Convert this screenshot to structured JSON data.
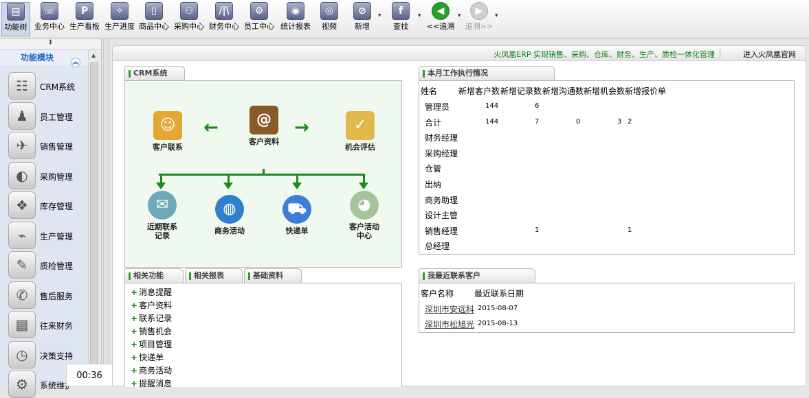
{
  "toolbar": [
    {
      "label": "功能树",
      "icon": "function-tree-icon",
      "glyph": "▤"
    },
    {
      "label": "业务中心",
      "icon": "business-center-icon",
      "glyph": "☏"
    },
    {
      "label": "生产看板",
      "icon": "production-board-icon",
      "glyph": "P"
    },
    {
      "label": "生产进度",
      "icon": "production-progress-icon",
      "glyph": "✧"
    },
    {
      "label": "商品中心",
      "icon": "product-center-icon",
      "glyph": "▯"
    },
    {
      "label": "采购中心",
      "icon": "purchase-center-icon",
      "glyph": "⚇"
    },
    {
      "label": "财务中心",
      "icon": "finance-center-icon",
      "glyph": "/|\\"
    },
    {
      "label": "员工中心",
      "icon": "staff-center-icon",
      "glyph": "⚙"
    },
    {
      "label": "统计报表",
      "icon": "statistics-report-icon",
      "glyph": "◉"
    },
    {
      "label": "视频",
      "icon": "video-icon",
      "glyph": "◎"
    },
    {
      "label": "新增",
      "icon": "add-new-icon",
      "glyph": "⊘"
    },
    {
      "label": "查找",
      "icon": "search-icon",
      "glyph": "f"
    },
    {
      "label": "<<追溯",
      "icon": "trace-back-icon",
      "glyph": "◀"
    },
    {
      "label": "追溯>>",
      "icon": "trace-forward-icon",
      "glyph": "▶"
    }
  ],
  "sidebar": {
    "collapse": "⇞",
    "title": "功能模块",
    "items": [
      {
        "label": "CRM系统",
        "icon": "crm-icon",
        "glyph": "☷"
      },
      {
        "label": "员工管理",
        "icon": "staff-icon",
        "glyph": "♟"
      },
      {
        "label": "销售管理",
        "icon": "sales-icon",
        "glyph": "✈"
      },
      {
        "label": "采购管理",
        "icon": "purchase-icon",
        "glyph": "◐"
      },
      {
        "label": "库存管理",
        "icon": "inventory-icon",
        "glyph": "❖"
      },
      {
        "label": "生产管理",
        "icon": "production-icon",
        "glyph": "⌁"
      },
      {
        "label": "质检管理",
        "icon": "quality-icon",
        "glyph": "✎"
      },
      {
        "label": "售后服务",
        "icon": "after-sales-icon",
        "glyph": "✆"
      },
      {
        "label": "往来财务",
        "icon": "accounts-icon",
        "glyph": "▦"
      },
      {
        "label": "决策支持",
        "icon": "decision-icon",
        "glyph": "◷"
      },
      {
        "label": "系统维护",
        "icon": "system-icon",
        "glyph": "⚙"
      }
    ],
    "time": "00:36"
  },
  "banner": {
    "slogan": "火凤凰ERP 实现销售、采购、仓库、财务、生产、质检一体化管理",
    "link": "进入火凤凰官网"
  },
  "crm": {
    "tab": "CRM系统",
    "top": [
      {
        "label": "客户联系",
        "icon": "customer-contact-icon",
        "glyph": "☺"
      },
      {
        "label": "客户资料",
        "icon": "customer-data-icon",
        "glyph": "@"
      },
      {
        "label": "机会评估",
        "icon": "opportunity-icon",
        "glyph": "✓"
      }
    ],
    "bottom": [
      {
        "label": "近期联系记录",
        "icon": "contact-record-icon",
        "glyph": "✉"
      },
      {
        "label": "商务活动",
        "icon": "business-activity-icon",
        "glyph": "◍"
      },
      {
        "label": "快递单",
        "icon": "express-icon",
        "glyph": "⛟"
      },
      {
        "label": "客户活动中心",
        "icon": "activity-center-icon",
        "glyph": "◕"
      }
    ]
  },
  "related": {
    "tabs": [
      "相关功能",
      "相关报表",
      "基础资料"
    ],
    "items": [
      "消息提醒",
      "客户资料",
      "联系记录",
      "销售机会",
      "项目管理",
      "快递单",
      "商务活动",
      "提醒消息"
    ]
  },
  "stats": {
    "tab": "本月工作执行情况",
    "headers": [
      "姓名",
      "新增客户数",
      "新增记录数",
      "新增沟通数",
      "新增机会数",
      "新增报价单"
    ],
    "rows": [
      {
        "name": "管理员",
        "v": [
          "144",
          "6",
          "",
          "",
          ""
        ]
      },
      {
        "name": "合计",
        "v": [
          "144",
          "7",
          "0",
          "3",
          "2"
        ]
      },
      {
        "name": "财务经理",
        "v": [
          "",
          "",
          "",
          "",
          ""
        ]
      },
      {
        "name": "采购经理",
        "v": [
          "",
          "",
          "",
          "",
          ""
        ]
      },
      {
        "name": "仓管",
        "v": [
          "",
          "",
          "",
          "",
          ""
        ]
      },
      {
        "name": "出纳",
        "v": [
          "",
          "",
          "",
          "",
          ""
        ]
      },
      {
        "name": "商务助理",
        "v": [
          "",
          "",
          "",
          "",
          ""
        ]
      },
      {
        "name": "设计主管",
        "v": [
          "",
          "",
          "",
          "",
          ""
        ]
      },
      {
        "name": "销售经理",
        "v": [
          "",
          "1",
          "",
          "",
          "1"
        ]
      },
      {
        "name": "总经理",
        "v": [
          "",
          "",
          "",
          "",
          ""
        ]
      }
    ]
  },
  "customers": {
    "tab": "我最近联系客户",
    "headers": [
      "客户名称",
      "最近联系日期"
    ],
    "rows": [
      {
        "name": "深圳市安远科",
        "date": "2015-08-07"
      },
      {
        "name": "深圳市松旭光",
        "date": "2015-08-13"
      }
    ]
  },
  "colors": {
    "accent": "#1e8a1e",
    "sidebar_title": "#1b61c4"
  }
}
